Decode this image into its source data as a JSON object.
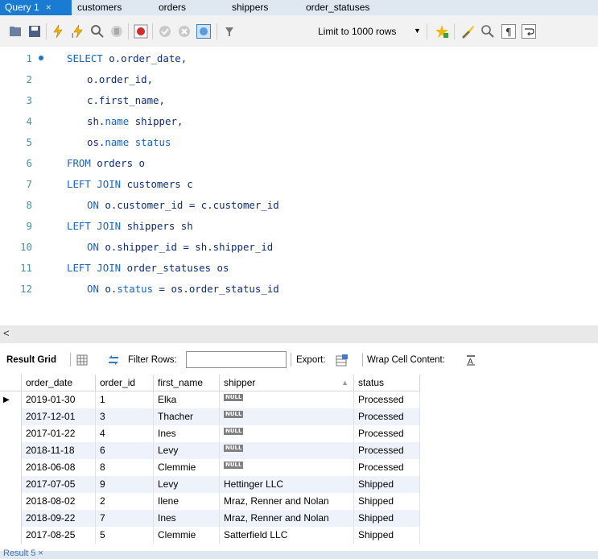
{
  "tabs": [
    {
      "label": "Query 1",
      "active": true
    },
    {
      "label": "customers",
      "active": false
    },
    {
      "label": "orders",
      "active": false
    },
    {
      "label": "shippers",
      "active": false
    },
    {
      "label": "order_statuses",
      "active": false
    }
  ],
  "tab_close": "×",
  "toolbar": {
    "limit_label": "Limit to 1000 rows",
    "limit_arrow": "▼",
    "icons": [
      "open-folder-icon",
      "save-icon",
      "execute-icon",
      "execute-current-icon",
      "explain-icon",
      "stop-icon",
      "toggle-error-icon",
      "commit-icon",
      "rollback-icon",
      "autocommit-icon",
      "add-snippet-icon",
      "beautify-icon",
      "find-icon",
      "invisible-chars-icon",
      "wrap-lines-icon"
    ]
  },
  "editor": {
    "lines": [
      {
        "num": "1",
        "parts": [
          [
            "kw",
            "SELECT"
          ],
          [
            "t",
            " o.order_date,"
          ]
        ],
        "indent": 0
      },
      {
        "num": "2",
        "parts": [
          [
            "t",
            "o.order_id,"
          ]
        ],
        "indent": 1
      },
      {
        "num": "3",
        "parts": [
          [
            "t",
            "c.first_name,"
          ]
        ],
        "indent": 1
      },
      {
        "num": "4",
        "parts": [
          [
            "t",
            "sh."
          ],
          [
            "kw",
            "name"
          ],
          [
            "t",
            " shipper,"
          ]
        ],
        "indent": 1
      },
      {
        "num": "5",
        "parts": [
          [
            "t",
            "os."
          ],
          [
            "kw",
            "name"
          ],
          [
            "t",
            " "
          ],
          [
            "kw",
            "status"
          ]
        ],
        "indent": 1
      },
      {
        "num": "6",
        "parts": [
          [
            "kw",
            "FROM"
          ],
          [
            "t",
            " orders o"
          ]
        ],
        "indent": 0
      },
      {
        "num": "7",
        "parts": [
          [
            "kw",
            "LEFT JOIN"
          ],
          [
            "t",
            " customers c"
          ]
        ],
        "indent": 0
      },
      {
        "num": "8",
        "parts": [
          [
            "kw",
            "ON"
          ],
          [
            "t",
            " o.customer_id = c.customer_id"
          ]
        ],
        "indent": 1
      },
      {
        "num": "9",
        "parts": [
          [
            "kw",
            "LEFT JOIN"
          ],
          [
            "t",
            " shippers sh"
          ]
        ],
        "indent": 0
      },
      {
        "num": "10",
        "parts": [
          [
            "kw",
            "ON"
          ],
          [
            "t",
            " o.shipper_id = sh.shipper_id"
          ]
        ],
        "indent": 1
      },
      {
        "num": "11",
        "parts": [
          [
            "kw",
            "LEFT JOIN"
          ],
          [
            "t",
            " order_statuses os"
          ]
        ],
        "indent": 0
      },
      {
        "num": "12",
        "parts": [
          [
            "kw",
            "ON"
          ],
          [
            "t",
            " o."
          ],
          [
            "kw",
            "status"
          ],
          [
            "t",
            " = os.order_status_id"
          ]
        ],
        "indent": 1
      }
    ]
  },
  "scroll_left_arrow": "<",
  "result_toolbar": {
    "result_grid_label": "Result Grid",
    "filter_rows_label": "Filter Rows:",
    "filter_value": "",
    "export_label": "Export:",
    "wrap_label": "Wrap Cell Content:"
  },
  "grid": {
    "columns": [
      "order_date",
      "order_id",
      "first_name",
      "shipper",
      "status"
    ],
    "sort_arrow": "▲",
    "null_label": "NULL",
    "rows": [
      [
        "2019-01-30",
        "1",
        "Elka",
        null,
        "Processed"
      ],
      [
        "2017-12-01",
        "3",
        "Thacher",
        null,
        "Processed"
      ],
      [
        "2017-01-22",
        "4",
        "Ines",
        null,
        "Processed"
      ],
      [
        "2018-11-18",
        "6",
        "Levy",
        null,
        "Processed"
      ],
      [
        "2018-06-08",
        "8",
        "Clemmie",
        null,
        "Processed"
      ],
      [
        "2017-07-05",
        "9",
        "Levy",
        "Hettinger LLC",
        "Shipped"
      ],
      [
        "2018-08-02",
        "2",
        "Ilene",
        "Mraz, Renner and Nolan",
        "Shipped"
      ],
      [
        "2018-09-22",
        "7",
        "Ines",
        "Mraz, Renner and Nolan",
        "Shipped"
      ],
      [
        "2017-08-25",
        "5",
        "Clemmie",
        "Satterfield LLC",
        "Shipped"
      ]
    ]
  },
  "bottom_tab": "Result 5 ×"
}
